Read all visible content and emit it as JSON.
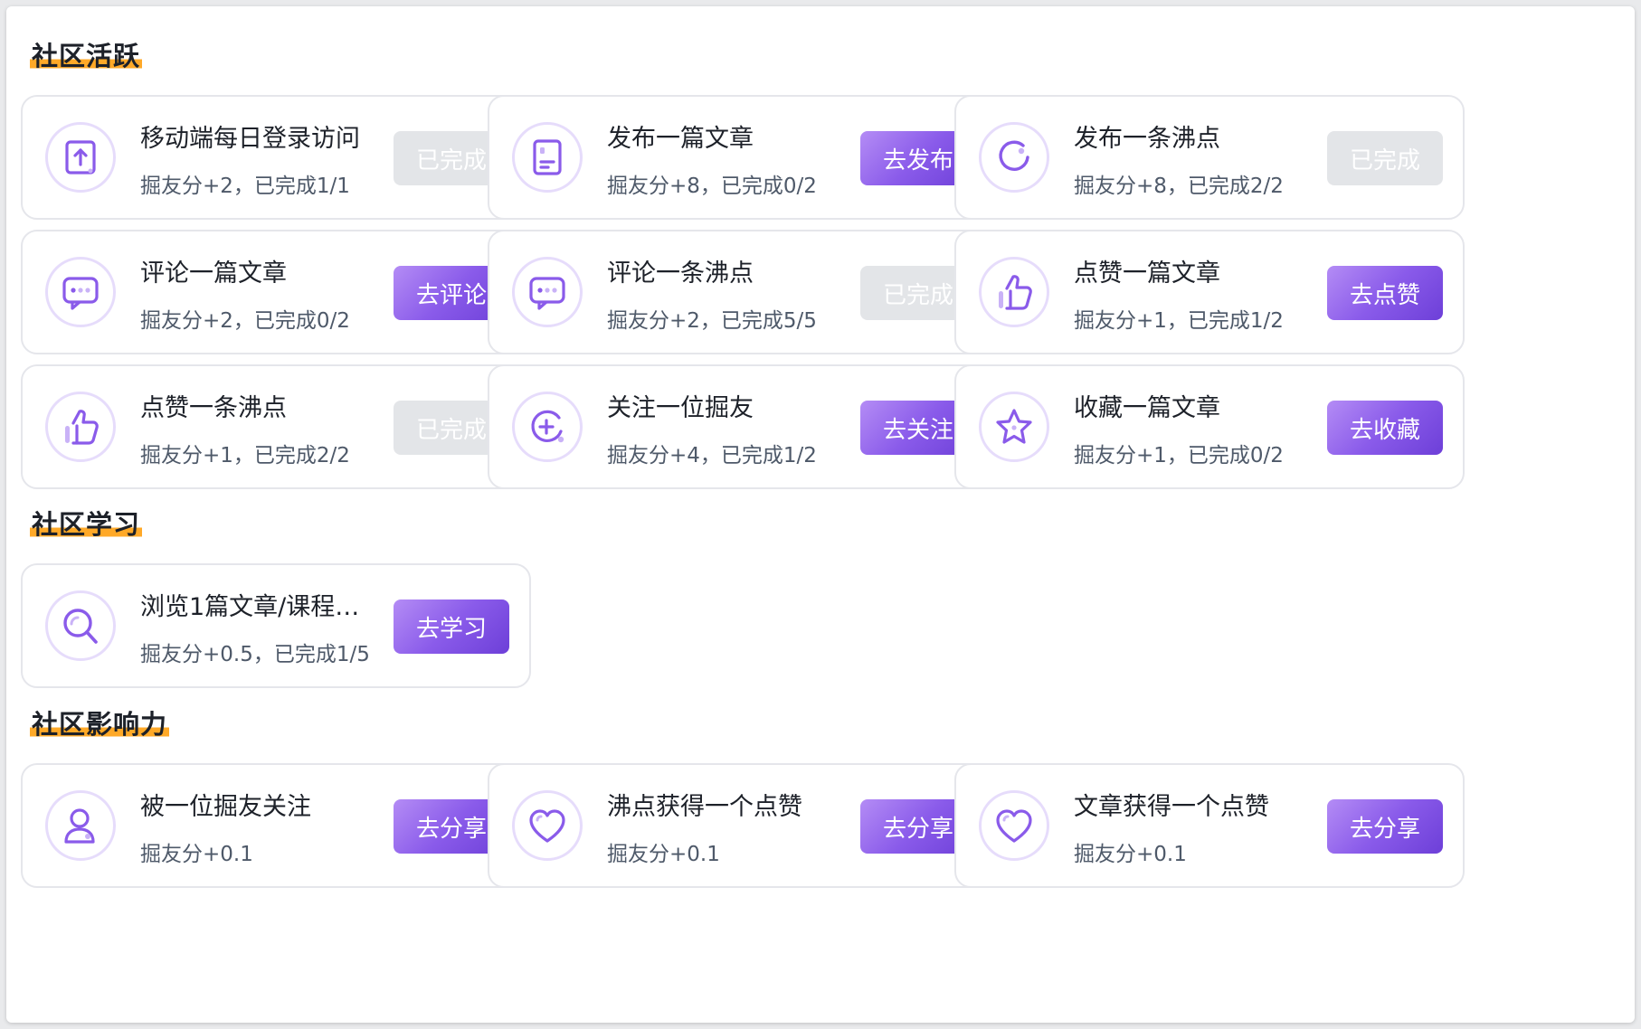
{
  "sections": [
    {
      "title": "社区活跃",
      "tasks": [
        {
          "title": "移动端每日登录访问",
          "desc": "掘友分+2，已完成1/1",
          "button": "已完成",
          "status": "done",
          "icon": "mobile-login-icon"
        },
        {
          "title": "发布一篇文章",
          "desc": "掘友分+8，已完成0/2",
          "button": "去发布",
          "status": "todo",
          "icon": "article-icon"
        },
        {
          "title": "发布一条沸点",
          "desc": "掘友分+8，已完成2/2",
          "button": "已完成",
          "status": "done",
          "icon": "pin-icon"
        },
        {
          "title": "评论一篇文章",
          "desc": "掘友分+2，已完成0/2",
          "button": "去评论",
          "status": "todo",
          "icon": "comment-icon"
        },
        {
          "title": "评论一条沸点",
          "desc": "掘友分+2，已完成5/5",
          "button": "已完成",
          "status": "done",
          "icon": "comment-icon"
        },
        {
          "title": "点赞一篇文章",
          "desc": "掘友分+1，已完成1/2",
          "button": "去点赞",
          "status": "todo",
          "icon": "thumbs-up-icon"
        },
        {
          "title": "点赞一条沸点",
          "desc": "掘友分+1，已完成2/2",
          "button": "已完成",
          "status": "done",
          "icon": "thumbs-up-icon"
        },
        {
          "title": "关注一位掘友",
          "desc": "掘友分+4，已完成1/2",
          "button": "去关注",
          "status": "todo",
          "icon": "follow-plus-icon"
        },
        {
          "title": "收藏一篇文章",
          "desc": "掘友分+1，已完成0/2",
          "button": "去收藏",
          "status": "todo",
          "icon": "star-icon"
        }
      ]
    },
    {
      "title": "社区学习",
      "tasks": [
        {
          "title": "浏览1篇文章/课程/...",
          "desc": "掘友分+0.5，已完成1/5",
          "button": "去学习",
          "status": "todo",
          "icon": "search-icon"
        }
      ]
    },
    {
      "title": "社区影响力",
      "tasks": [
        {
          "title": "被一位掘友关注",
          "desc": "掘友分+0.1",
          "button": "去分享",
          "status": "todo",
          "icon": "user-icon"
        },
        {
          "title": "沸点获得一个点赞",
          "desc": "掘友分+0.1",
          "button": "去分享",
          "status": "todo",
          "icon": "heart-icon"
        },
        {
          "title": "文章获得一个点赞",
          "desc": "掘友分+0.1",
          "button": "去分享",
          "status": "todo",
          "icon": "heart-icon"
        }
      ]
    }
  ],
  "colors": {
    "accent_start": "#b48cf5",
    "accent_end": "#6d3fd8",
    "icon_stroke": "#8a5bea",
    "done_bg": "#e3e5e8",
    "title_highlight": "#ffa928"
  }
}
